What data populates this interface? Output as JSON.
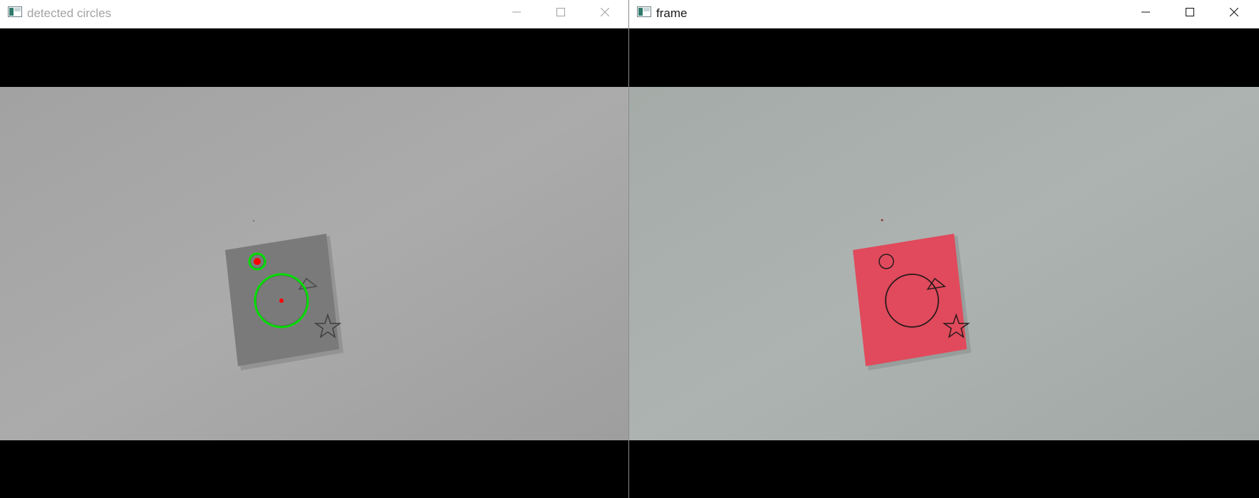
{
  "left_window": {
    "title": "detected circles",
    "controls": [
      "minimize-icon",
      "maximize-icon",
      "close-icon"
    ],
    "image": {
      "kind": "grayscale camera frame",
      "overlay_circle_color": "#00e000",
      "center_point_color": "#ff0000",
      "detected_circle_count": 2
    }
  },
  "right_window": {
    "title": "frame",
    "controls": [
      "minimize-icon",
      "maximize-icon",
      "close-icon"
    ],
    "image": {
      "kind": "color camera frame",
      "note_color": "#e04a5c"
    }
  },
  "colors": {
    "letterbox": "#000000",
    "wall_gray": "#a8a8a8",
    "wall_color": "#a9b0ad",
    "title_inactive": "#a3a3a3",
    "title_active": "#1a1a1a"
  }
}
